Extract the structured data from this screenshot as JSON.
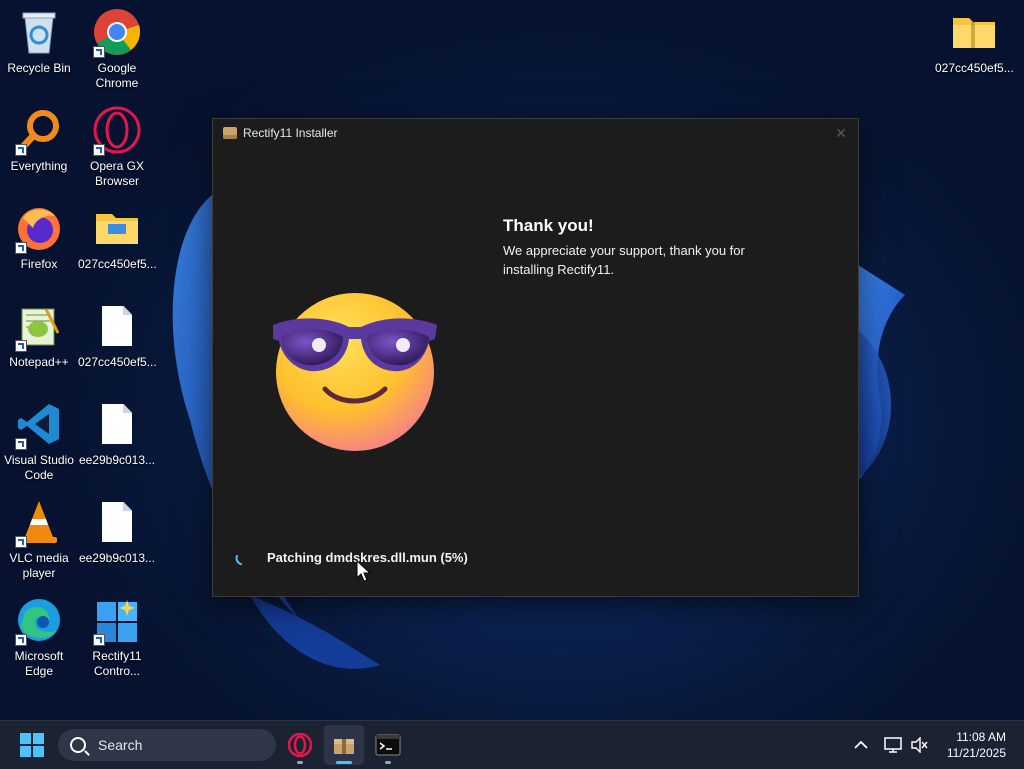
{
  "desktop": {
    "icons": [
      {
        "label": "Recycle Bin",
        "icon": "recycle-bin-icon"
      },
      {
        "label": "Google Chrome",
        "icon": "chrome-icon"
      },
      {
        "label": "Everything",
        "icon": "everything-search-icon"
      },
      {
        "label": "Opera GX Browser",
        "icon": "opera-gx-icon"
      },
      {
        "label": "Firefox",
        "icon": "firefox-icon"
      },
      {
        "label": "027cc450ef5...",
        "icon": "folder-icon"
      },
      {
        "label": "Notepad++",
        "icon": "notepad-plus-plus-icon"
      },
      {
        "label": "027cc450ef5...",
        "icon": "file-icon"
      },
      {
        "label": "Visual Studio Code",
        "icon": "vscode-icon"
      },
      {
        "label": "ee29b9c013...",
        "icon": "file-icon"
      },
      {
        "label": "VLC media player",
        "icon": "vlc-icon"
      },
      {
        "label": "ee29b9c013...",
        "icon": "file-icon"
      },
      {
        "label": "Microsoft Edge",
        "icon": "edge-icon"
      },
      {
        "label": "Rectify11 Contro...",
        "icon": "rectify11-control-icon"
      },
      {
        "label": "027cc450ef5...",
        "icon": "zip-folder-icon"
      }
    ]
  },
  "installer": {
    "title": "Rectify11 Installer",
    "close_glyph": "✕",
    "heading": "Thank you!",
    "message": "We appreciate your support, thank you for installing Rectify11.",
    "status": "Patching dmdskres.dll.mun (5%)"
  },
  "taskbar": {
    "search_placeholder": "Search",
    "time": "11:08 AM",
    "date": "11/21/2025",
    "accent": "#4cc2ff"
  }
}
